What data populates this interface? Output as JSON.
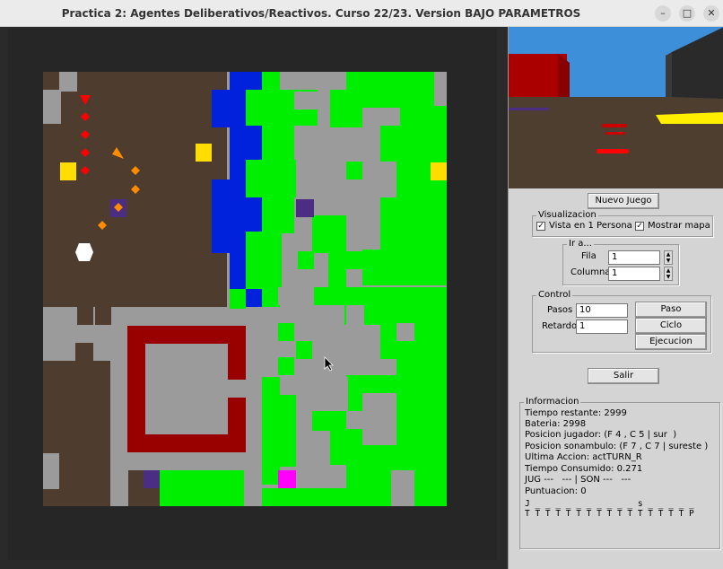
{
  "window": {
    "title": "Practica 2: Agentes Deliberativos/Reactivos. Curso 22/23. Version BAJO PARAMETROS",
    "min_icon": "minimize-icon",
    "max_icon": "maximize-icon",
    "close_icon": "close-icon"
  },
  "map": {
    "rows": [
      "ABBBBBBBBBBAAAAAAAAAAAAA",
      "BABBBBBBBBBAAAAAAAAAAAAA",
      "AABBBBBBBBBAAAAAAAAAAAAA",
      "ABBBBBBBBBBAAAAAAAAAAAAA",
      "BBBBBBBBBBBAAAAAAAAAAAAA",
      "BBBBBBBBBBBAAAAAAAAAAAAA",
      "BBBBBBBBBBBAAAAAAAAAAAAA",
      "BBBBBBBBBBBAAAAAAAAAAAAA",
      "BBBBBBBBBBBAAAAAAAAAAAAA",
      "BBBBBBBBBBBAAAAAAAAAAAAA",
      "BBBBBBBBBBBAAAAAAAAAAAAA",
      "BBBBBBBBBBBAAAAAAAAAAAAA",
      "BBBBBBBBBBBAAAAAAAAAAAAA",
      "BBBBBBBBBBBAAAAAAAAAAAAA",
      "ABBABBAAAAAAAAAAAAAAAAAA",
      "AAAAAAAAAAAAAAAAAAAAAAAA",
      "BBBAAAAAAAAAAAAAAAAAAAAA",
      "BBBBAAAAAAAAAAAAAAAAAAAA",
      "BBBBAAAAAAAAAAAAAAAAAAAA",
      "BBBBAAAAAAAAAAAAAAAAAAAA",
      "BBBBAAAAAAAAAAAAAAAAAAAA",
      "BBBBAAAAAAAAAAAAAAAAAAAA",
      "BBBAAAAAAAAAAAAAAAAAAAAA",
      "ABBAAAAAAAAAAAAAAAAAAAAA",
      "AAAAAAAAAAAAAAAAAAAAAAAA",
      "ABAAAAABBAAAAAAAAAAAAAAA"
    ],
    "colors": {
      "land": "#4e3c2e",
      "rock": "#9b9b9b",
      "water": "#0022dd",
      "forest": "#00ee00",
      "wall": "#990000",
      "goal": "#ffdd00",
      "pit": "#4b2e83",
      "player": "#ff0000",
      "sleepwalker": "#ff8c00",
      "magenta": "#ff00ff",
      "white": "#ffffff"
    }
  },
  "controls": {
    "new_game": "Nuevo Juego",
    "visualizacion_label": "Visualizacion",
    "vista_label": "Vista en 1 Persona",
    "mapa_label": "Mostrar mapa",
    "ir_label": "Ir a...",
    "fila_label": "Fila",
    "fila_value": "1",
    "columna_label": "Columna",
    "columna_value": "1",
    "control_label": "Control",
    "pasos_label": "Pasos",
    "pasos_value": "10",
    "retardo_label": "Retardo",
    "retardo_value": "1",
    "paso_btn": "Paso",
    "ciclo_btn": "Ciclo",
    "ejecucion_btn": "Ejecucion",
    "salir_btn": "Salir"
  },
  "info": {
    "label": "Informacion",
    "tiempo_restante": "Tiempo restante: 2999",
    "bateria": "Bateria: 2998",
    "pos_jugador": "Posicion jugador: (F 4 , C 5 | sur  )",
    "pos_sonambulo": "Posicion sonambulo: (F 7 , C 7 | sureste )",
    "ultima_accion": "Ultima Accion: actTURN_R",
    "tiempo_consumido": "Tiempo Consumido: 0.271",
    "jug_son": "JUG ---   --- | SON ---   ---",
    "puntuacion": "Puntuacion: 0",
    "row1": "J _ _ _ _ _ _ _ _ _ _ s _ _ _ _ _",
    "row2": "T T T T T T T T T T T T T T T T P"
  }
}
